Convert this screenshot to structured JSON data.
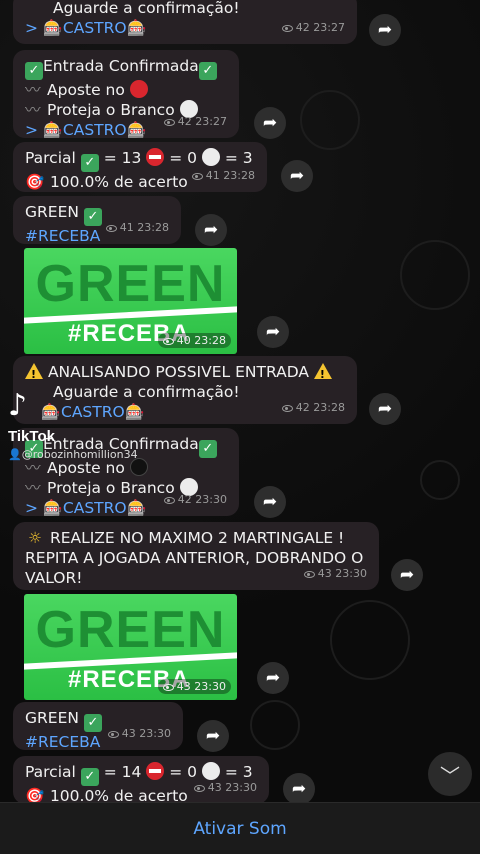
{
  "messages": {
    "m1": {
      "l1": "Aguarde a confirmação!",
      "l2": "CASTRO",
      "views": "42",
      "time": "23:27"
    },
    "m2": {
      "l1": "Entrada Confirmada",
      "l2": "Aposte no",
      "l3": "Proteja o Branco",
      "l4": "CASTRO",
      "views": "42",
      "time": "23:27"
    },
    "m3": {
      "p1": "Parcial",
      "p2": "= 13",
      "p3": "= 0",
      "p4": "= 3",
      "l2": "100.0% de acerto",
      "views": "41",
      "time": "23:28"
    },
    "m4": {
      "l1": "GREEN",
      "l2": "#RECEBA",
      "views": "41",
      "time": "23:28"
    },
    "img1": {
      "big": "GREEN",
      "tag": "#RECEBA",
      "views": "40",
      "time": "23:28"
    },
    "m5": {
      "l1": "ANALISANDO POSSIVEL ENTRADA",
      "l2": "Aguarde a confirmação!",
      "l3": "CASTRO",
      "views": "42",
      "time": "23:28"
    },
    "m6": {
      "l1": "Entrada Confirmada",
      "l2": "Aposte no",
      "l3": "Proteja o Branco",
      "l4": "CASTRO",
      "views": "42",
      "time": "23:30"
    },
    "m7": {
      "l1": "REALIZE NO MAXIMO 2 MARTINGALE !",
      "l2": "REPITA A JOGADA ANTERIOR, DOBRANDO O",
      "l3": "VALOR!",
      "views": "43",
      "time": "23:30"
    },
    "img2": {
      "big": "GREEN",
      "tag": "#RECEBA",
      "views": "43",
      "time": "23:30"
    },
    "m8": {
      "l1": "GREEN",
      "l2": "#RECEBA",
      "views": "43",
      "time": "23:30"
    },
    "m9": {
      "p1": "Parcial",
      "p2": "= 14",
      "p3": "= 0",
      "p4": "= 3",
      "l2": "100.0% de acerto",
      "views": "43",
      "time": "23:30"
    }
  },
  "tiktok": {
    "brand": "TikTok",
    "user": "@robozinhomillion34"
  },
  "bottom": {
    "label": "Ativar Som"
  },
  "colors": {
    "link": "#5ea6ff",
    "bubble": "#272125",
    "green": "#2bbf44"
  }
}
